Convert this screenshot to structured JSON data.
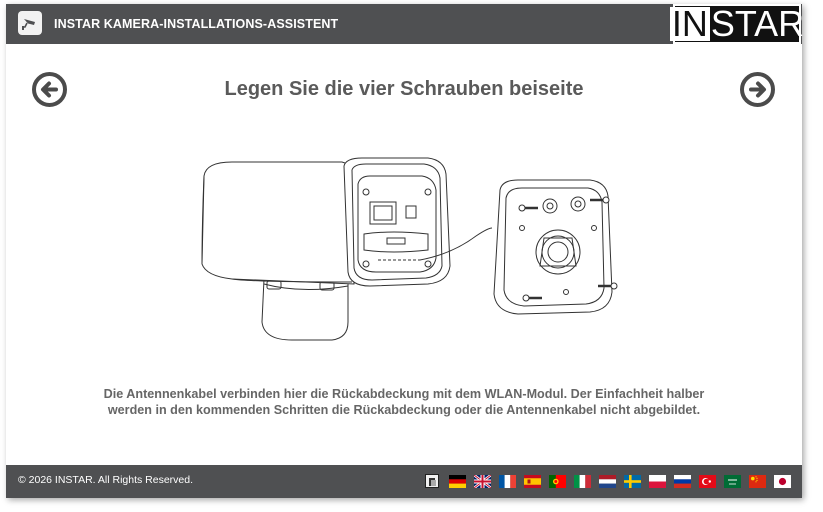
{
  "header": {
    "title": "INSTAR KAMERA-INSTALLATIONS-ASSISTENT",
    "logo_text_left": "IN",
    "logo_text_right": "STAR"
  },
  "main": {
    "title": "Legen Sie die vier Schrauben beiseite",
    "description_line1": "Die Antennenkabel verbinden hier die Rückabdeckung mit dem WLAN-Modul. Der Einfachheit halber",
    "description_line2": "werden in den kommenden Schritten die Rückabdeckung oder die Antennenkabel nicht abgebildet."
  },
  "footer": {
    "copyright": "© 2026 INSTAR. All Rights Reserved."
  },
  "colors": {
    "header_bg": "#4f5052",
    "title_text": "#5a5a5a",
    "description_text": "#666666"
  },
  "languages": [
    "german-flag",
    "uk-flag",
    "french-flag",
    "spanish-flag",
    "portuguese-flag",
    "italian-flag",
    "dutch-flag",
    "swedish-flag",
    "polish-flag",
    "russian-flag",
    "turkish-flag",
    "saudi-flag",
    "chinese-flag",
    "japanese-flag"
  ]
}
